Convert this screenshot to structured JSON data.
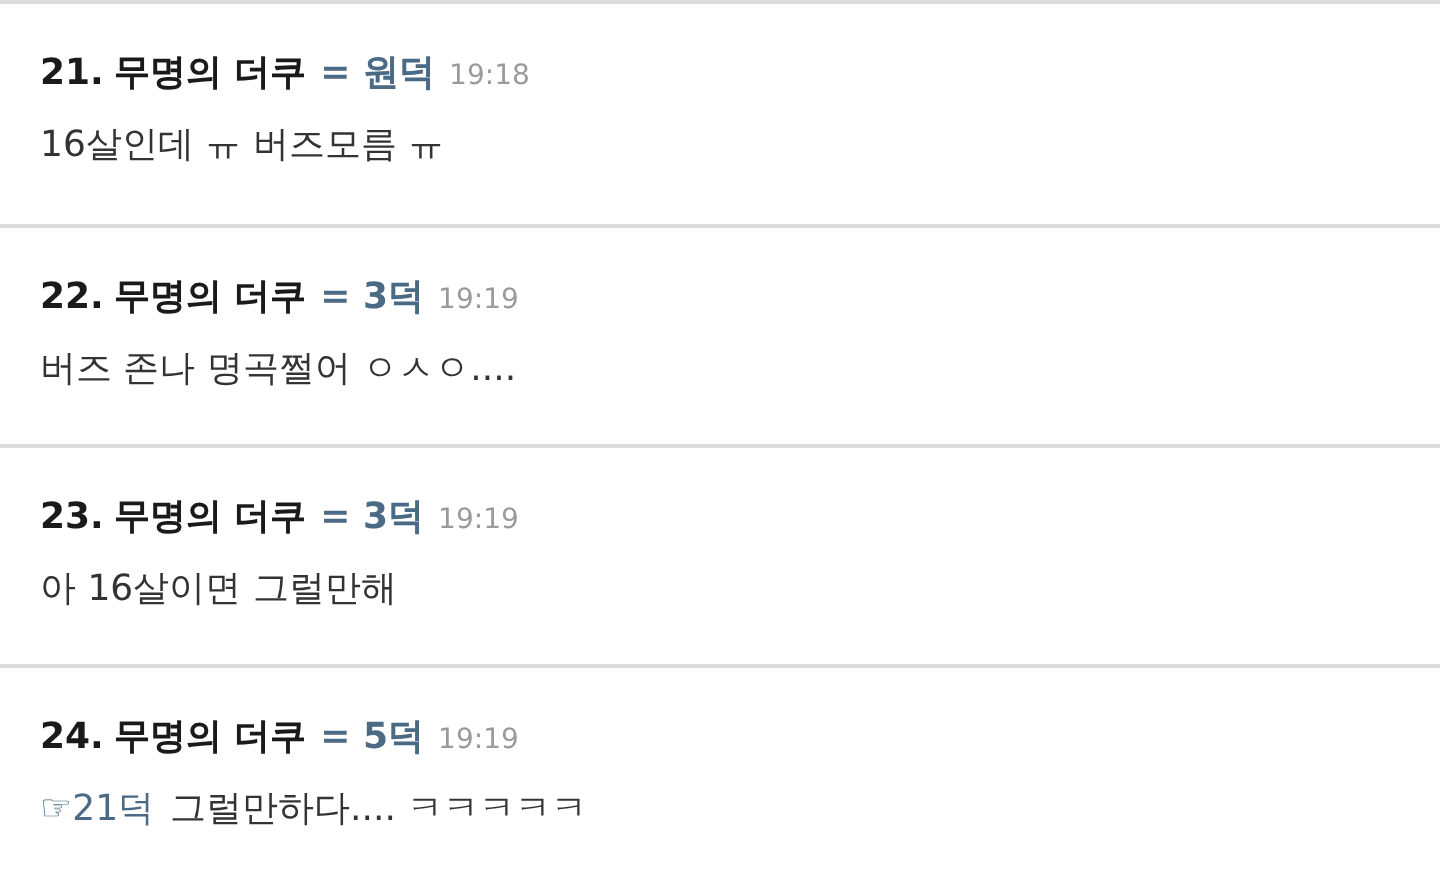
{
  "comments": [
    {
      "number": "21.",
      "author": "무명의 더쿠",
      "rank": "= 원덕",
      "time": "19:18",
      "text": "16살인데 ㅠ 버즈모름 ㅠ"
    },
    {
      "number": "22.",
      "author": "무명의 더쿠",
      "rank": "= 3덕",
      "time": "19:19",
      "text": "버즈 존나 명곡쩔어 ㅇㅅㅇ...."
    },
    {
      "number": "23.",
      "author": "무명의 더쿠",
      "rank": "= 3덕",
      "time": "19:19",
      "text": "아 16살이면 그럴만해"
    },
    {
      "number": "24.",
      "author": "무명의 더쿠",
      "rank": "= 5덕",
      "time": "19:19",
      "reply": "☞21덕",
      "text": "그럴만하다.... ㅋㅋㅋㅋㅋ"
    }
  ]
}
